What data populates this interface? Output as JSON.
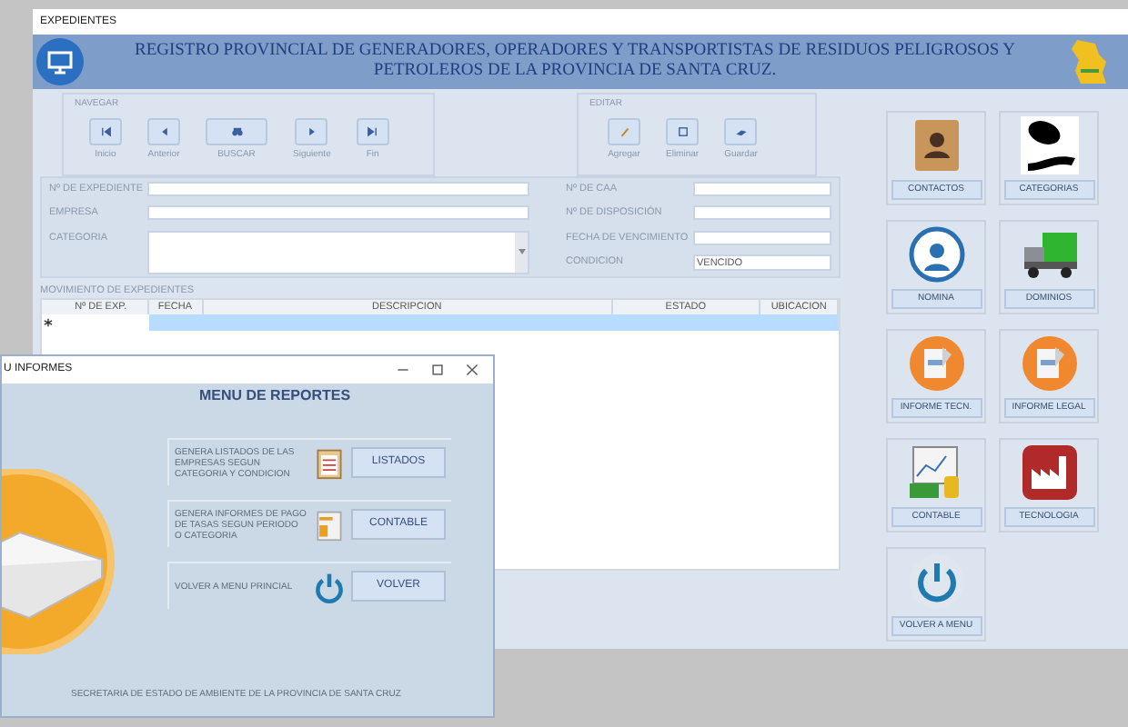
{
  "window": {
    "title": "EXPEDIENTES"
  },
  "header": {
    "title": "REGISTRO PROVINCIAL DE GENERADORES, OPERADORES Y TRANSPORTISTAS DE RESIDUOS PELIGROSOS Y PETROLEROS DE LA PROVINCIA DE SANTA CRUZ."
  },
  "navigation": {
    "label": "NAVEGAR",
    "buttons": [
      {
        "label": "Inicio",
        "kind": "first"
      },
      {
        "label": "Anterior",
        "kind": "prev"
      },
      {
        "label": "BUSCAR",
        "kind": "search"
      },
      {
        "label": "Siguiente",
        "kind": "next"
      },
      {
        "label": "Fin",
        "kind": "last"
      }
    ]
  },
  "edit": {
    "label": "EDITAR",
    "buttons": [
      {
        "label": "Agregar",
        "kind": "add"
      },
      {
        "label": "Eliminar",
        "kind": "delete"
      },
      {
        "label": "Guardar",
        "kind": "save"
      }
    ]
  },
  "form": {
    "left": [
      {
        "label": "Nº DE EXPEDIENTE",
        "kind": "text"
      },
      {
        "label": "EMPRESA",
        "kind": "text"
      },
      {
        "label": "CATEGORIA",
        "kind": "list"
      }
    ],
    "right": [
      {
        "label": "Nº DE CAA"
      },
      {
        "label": "Nº DE DISPOSICIÓN"
      },
      {
        "label": "FECHA DE VENCIMIENTO"
      },
      {
        "label": "CONDICION",
        "value": "VENCIDO"
      }
    ]
  },
  "movements": {
    "label": "MOVIMIENTO DE EXPEDIENTES",
    "columns": [
      "Nº DE EXP.",
      "FECHA",
      "DESCRIPCION",
      "ESTADO",
      "UBICACION"
    ]
  },
  "modules": [
    {
      "label": "CONTACTOS",
      "kind": "contacts"
    },
    {
      "label": "CATEGORIAS",
      "kind": "barrel"
    },
    {
      "label": "NOMINA",
      "kind": "person"
    },
    {
      "label": "DOMINIOS",
      "kind": "truck"
    },
    {
      "label": "INFORME TECN.",
      "kind": "report"
    },
    {
      "label": "INFORME LEGAL",
      "kind": "report"
    },
    {
      "label": "CONTABLE",
      "kind": "money"
    },
    {
      "label": "TECNOLOGIA",
      "kind": "factory"
    },
    {
      "label": "VOLVER A MENU",
      "kind": "power"
    }
  ],
  "reports_dialog": {
    "title": "U INFORMES",
    "heading": "MENU DE REPORTES",
    "items": [
      {
        "description": "GENERA LISTADOS DE LAS EMPRESAS SEGUN CATEGORIA Y CONDICION",
        "button": "LISTADOS",
        "kind": "clipboard"
      },
      {
        "description": "GENERA INFORMES DE PAGO DE TASAS SEGUN PERIODO O CATEGORIA",
        "button": "CONTABLE",
        "kind": "document"
      },
      {
        "description": "VOLVER A MENU PRINCIAL",
        "button": "VOLVER",
        "kind": "power"
      }
    ],
    "footer": "SECRETARIA DE ESTADO DE AMBIENTE DE LA PROVINCIA DE SANTA CRUZ"
  }
}
